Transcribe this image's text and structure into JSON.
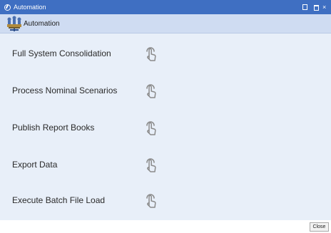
{
  "window": {
    "title": "Automation"
  },
  "toolbar": {
    "label": "Automation"
  },
  "tasks": [
    {
      "label": "Full System Consolidation",
      "icon": "touch-run-icon"
    },
    {
      "label": "Process Nominal Scenarios",
      "icon": "touch-run-icon"
    },
    {
      "label": "Publish Report Books",
      "icon": "touch-run-icon"
    },
    {
      "label": "Export Data",
      "icon": "touch-run-icon"
    },
    {
      "label": "Execute Batch File Load",
      "icon": "touch-run-icon"
    }
  ],
  "footer": {
    "close_label": "Close"
  },
  "colors": {
    "titlebar": "#3f6fc2",
    "toolbar": "#cfdcf2",
    "content": "#e8eff9",
    "icon": "#8a8a8a"
  }
}
